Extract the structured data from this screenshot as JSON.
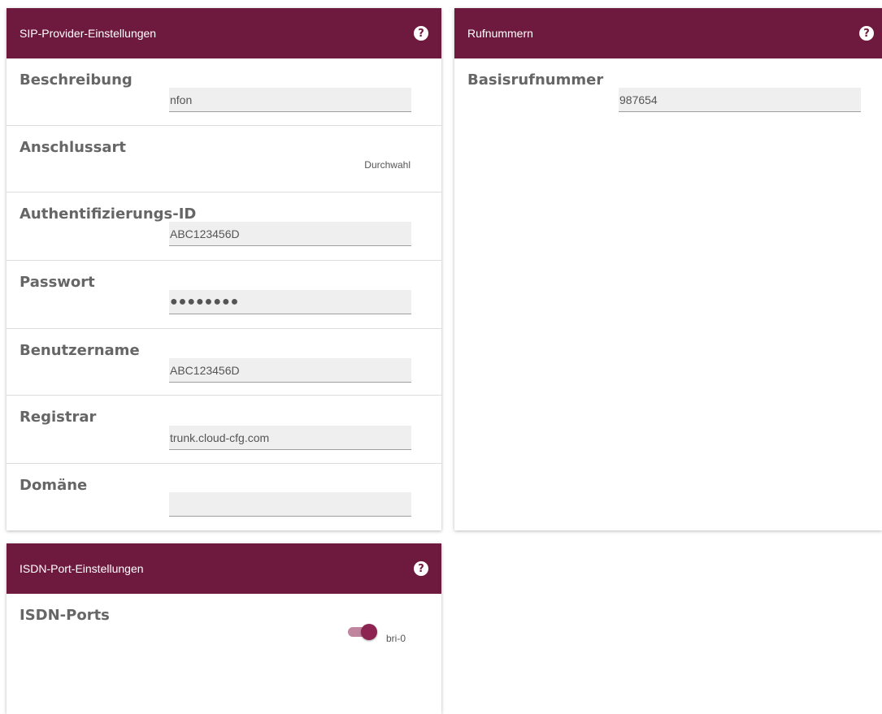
{
  "colors": {
    "header_bg": "#6e1a3f",
    "accent": "#8c2350",
    "text": "#555555"
  },
  "sip_provider": {
    "title": "SIP-Provider-Einstellungen",
    "help_icon": "question-circle-icon",
    "help_glyph": "?",
    "beschreibung": {
      "label": "Beschreibung",
      "value": "nfon"
    },
    "anschlussart": {
      "label": "Anschlussart",
      "value": "Durchwahl"
    },
    "auth_id": {
      "label": "Authentifizierungs-ID",
      "value": "ABC123456D"
    },
    "passwort": {
      "label": "Passwort",
      "value": "●●●●●●●●"
    },
    "benutzername": {
      "label": "Benutzername",
      "value": "ABC123456D"
    },
    "registrar": {
      "label": "Registrar",
      "value": "trunk.cloud-cfg.com"
    },
    "domaene": {
      "label": "Domäne",
      "value": ""
    }
  },
  "rufnummern": {
    "title": "Rufnummern",
    "help_icon": "question-circle-icon",
    "help_glyph": "?",
    "basisrufnummer": {
      "label": "Basisrufnummer",
      "value": "987654"
    }
  },
  "isdn": {
    "title": "ISDN-Port-Einstellungen",
    "help_icon": "question-circle-icon",
    "help_glyph": "?",
    "ports": {
      "label": "ISDN-Ports",
      "toggle_label": "bri-0",
      "enabled": true
    }
  }
}
